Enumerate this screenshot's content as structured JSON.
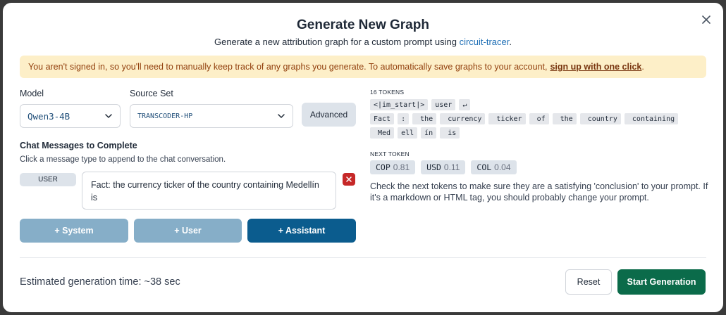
{
  "dialog": {
    "title": "Generate New Graph",
    "subtitle_text": "Generate a new attribution graph for a custom prompt using",
    "subtitle_link": "circuit-tracer",
    "subtitle_end": "."
  },
  "banner": {
    "text": "You aren't signed in, so you'll need to manually keep track of any graphs you generate. To automatically save graphs to your account,",
    "link": "sign up with one click",
    "end": "."
  },
  "model": {
    "label": "Model",
    "value": "Qwen3-4B"
  },
  "source_set": {
    "label": "Source Set",
    "value": "TRANSCODER-HP"
  },
  "advanced_label": "Advanced",
  "chat": {
    "title": "Chat Messages to Complete",
    "hint": "Click a message type to append to the chat conversation.",
    "messages": [
      {
        "role": "USER",
        "text": "Fact: the currency ticker of the country containing Medellín is"
      }
    ],
    "add_system": "+ System",
    "add_user": "+ User",
    "add_assistant": "+ Assistant"
  },
  "tokens": {
    "count_label": "16 TOKENS",
    "rows": [
      [
        "<|im_start|>",
        "user",
        "↵"
      ],
      [
        "Fact",
        ":",
        " the",
        " currency",
        " ticker",
        " of",
        " the",
        " country",
        " containing"
      ],
      [
        " Med",
        "ell",
        "ín",
        " is"
      ]
    ]
  },
  "next_token": {
    "label": "NEXT TOKEN",
    "items": [
      {
        "token": "COP",
        "prob": "0.81"
      },
      {
        "token": "USD",
        "prob": "0.11"
      },
      {
        "token": "COL",
        "prob": "0.04"
      }
    ],
    "note": "Check the next tokens to make sure they are a satisfying 'conclusion' to your prompt. If it's a markdown or HTML tag, you should probably change your prompt."
  },
  "footer": {
    "estimate": "Estimated generation time: ~38 sec",
    "reset": "Reset",
    "start": "Start Generation"
  },
  "colors": {
    "primary": "#0b5c8e",
    "primary_disabled": "#86aec8",
    "start": "#0b6b4a",
    "delete": "#c62828",
    "banner_bg": "#fdefc8"
  }
}
